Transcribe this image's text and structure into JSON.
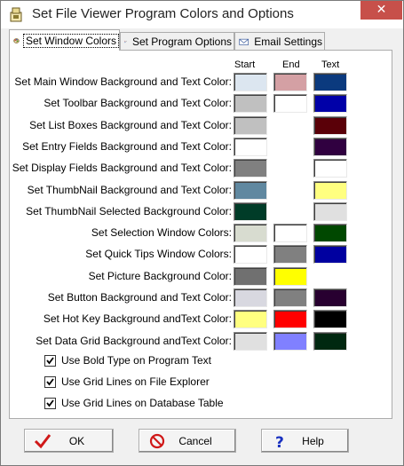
{
  "window": {
    "title": "Set File Viewer Program Colors and Options",
    "close_glyph": "✕"
  },
  "tabs": [
    {
      "label": "Set Window Colors",
      "icon": "palette-icon",
      "active": true
    },
    {
      "label": "Set Program Options",
      "icon": "wrench-icon",
      "active": false
    },
    {
      "label": "Email Settings",
      "icon": "envelope-icon",
      "active": false
    }
  ],
  "columns": {
    "start": "Start",
    "end": "End",
    "text": "Text"
  },
  "rows": [
    {
      "label": "Set Main Window Background and Text Color:",
      "start": "#dce6f0",
      "end": "#d4a0a4",
      "text": "#0b3a7e"
    },
    {
      "label": "Set Toolbar Background and Text Color:",
      "start": "#c0c0c0",
      "end": "#ffffff",
      "text": "#0000a8"
    },
    {
      "label": "Set List Boxes Background and Text Color:",
      "start": "#c0c0c0",
      "end": null,
      "text": "#5a0008"
    },
    {
      "label": "Set Entry Fields Background and Text Color:",
      "start": "#ffffff",
      "end": null,
      "text": "#300040"
    },
    {
      "label": "Set Display Fields Background and Text Color:",
      "start": "#808080",
      "end": null,
      "text": "#ffffff"
    },
    {
      "label": "Set ThumbNail Background and Text Color:",
      "start": "#6088a0",
      "end": null,
      "text": "#ffff80"
    },
    {
      "label": "Set ThumbNail Selected Background Color:",
      "start": "#003c28",
      "end": null,
      "text": "#e0e0e0"
    },
    {
      "label": "Set Selection Window Colors:",
      "start": "#d8dcd0",
      "end": "#ffffff",
      "text": "#004800"
    },
    {
      "label": "Set Quick Tips Window Colors:",
      "start": "#ffffff",
      "end": "#808080",
      "text": "#0000a0"
    },
    {
      "label": "Set Picture Background Color:",
      "start": "#707070",
      "end": "#ffff00",
      "text": null
    },
    {
      "label": "Set Button Background and Text Color:",
      "start": "#d8d8e0",
      "end": "#808080",
      "text": "#280030"
    },
    {
      "label": "Set Hot Key Background andText Color:",
      "start": "#ffff80",
      "end": "#ff0000",
      "text": "#000000"
    },
    {
      "label": "Set Data Grid Background andText Color:",
      "start": "#e0e0e0",
      "end": "#8080ff",
      "text": "#002810"
    }
  ],
  "options": [
    {
      "label": "Use Bold Type on Program Text",
      "checked": true
    },
    {
      "label": "Use Grid Lines on File Explorer",
      "checked": true
    },
    {
      "label": "Use Grid Lines on Database Table",
      "checked": true
    }
  ],
  "buttons": {
    "ok": {
      "label": "OK",
      "icon": "checkmark-icon"
    },
    "cancel": {
      "label": "Cancel",
      "icon": "no-sign-icon"
    },
    "help": {
      "label": "Help",
      "icon": "question-icon"
    }
  }
}
